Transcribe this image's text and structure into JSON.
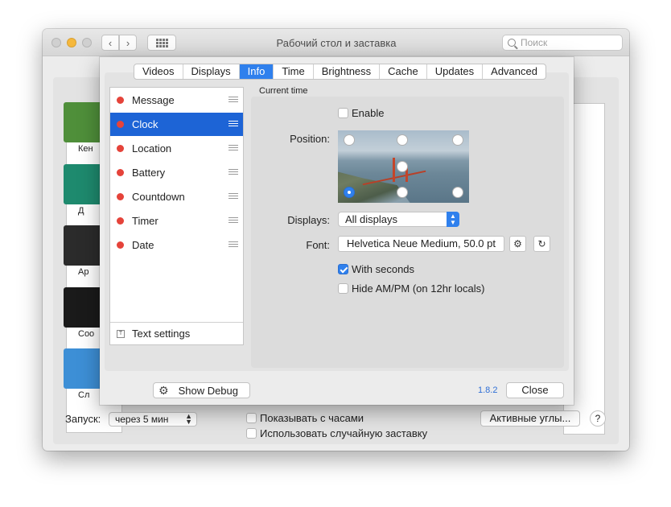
{
  "window": {
    "title": "Рабочий стол и заставка",
    "search_placeholder": "Поиск"
  },
  "saver_list": {
    "items": [
      {
        "label": "Кен",
        "color": "#4f8f3a"
      },
      {
        "label": "Д",
        "color": "#1e8a6e"
      },
      {
        "label": "Ар",
        "color": "#2b2b2b"
      },
      {
        "label": "Coo",
        "color": "#1a1a1a"
      },
      {
        "label": "Сл",
        "color": "#3d8fd6"
      }
    ]
  },
  "main_bottom": {
    "start_label": "Запуск:",
    "start_value": "через 5 мин",
    "show_with_clock": "Показывать с часами",
    "random_saver": "Использовать случайную заставку",
    "hot_corners": "Активные углы...",
    "help": "?"
  },
  "sheet": {
    "tabs": [
      {
        "label": "Videos",
        "active": false
      },
      {
        "label": "Displays",
        "active": false
      },
      {
        "label": "Info",
        "active": true
      },
      {
        "label": "Time",
        "active": false
      },
      {
        "label": "Brightness",
        "active": false
      },
      {
        "label": "Cache",
        "active": false
      },
      {
        "label": "Updates",
        "active": false
      },
      {
        "label": "Advanced",
        "active": false
      }
    ],
    "info_items": [
      {
        "label": "Message",
        "selected": false
      },
      {
        "label": "Clock",
        "selected": true
      },
      {
        "label": "Location",
        "selected": false
      },
      {
        "label": "Battery",
        "selected": false
      },
      {
        "label": "Countdown",
        "selected": false
      },
      {
        "label": "Timer",
        "selected": false
      },
      {
        "label": "Date",
        "selected": false
      }
    ],
    "text_settings": "Text settings",
    "section_title": "Current time",
    "enable_label": "Enable",
    "enable_checked": false,
    "position_label": "Position:",
    "position_selected": "bottom-left",
    "displays_label": "Displays:",
    "displays_value": "All displays",
    "font_label": "Font:",
    "font_value": "Helvetica Neue Medium, 50.0 pt",
    "with_seconds_label": "With seconds",
    "with_seconds_checked": true,
    "hide_ampm_label": "Hide AM/PM (on 12hr locals)",
    "hide_ampm_checked": false,
    "show_debug": "Show Debug",
    "version": "1.8.2",
    "close": "Close"
  },
  "colors": {
    "accent": "#2f80ed",
    "selected_row": "#1d64d6",
    "status_dot": "#e5433a",
    "link": "#2f6fd6"
  }
}
